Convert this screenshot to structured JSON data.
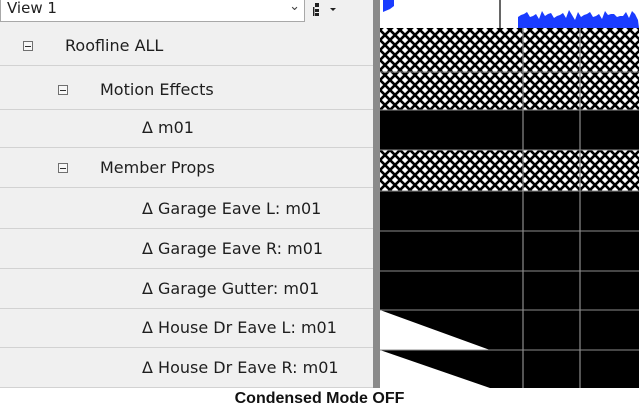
{
  "panel": {
    "view_selector": {
      "value": "View 1",
      "chevron": "chevron-down-icon"
    },
    "view_menu_icon": "tree-view-icon",
    "rows": [
      {
        "label": "Roofline ALL",
        "expandable": true
      },
      {
        "label": "Motion Effects",
        "expandable": true
      },
      {
        "label": "Δ m01",
        "expandable": false
      },
      {
        "label": "Member Props",
        "expandable": true
      },
      {
        "label": "Δ Garage Eave L: m01",
        "expandable": false
      },
      {
        "label": "Δ Garage Eave R: m01",
        "expandable": false
      },
      {
        "label": "Δ Garage Gutter: m01",
        "expandable": false
      },
      {
        "label": "Δ House Dr Eave L: m01",
        "expandable": false
      },
      {
        "label": "Δ House Dr Eave R: m01",
        "expandable": false
      }
    ]
  },
  "timeline": {
    "row_fills": [
      "pattern",
      "pattern",
      "black",
      "pattern",
      "black",
      "black",
      "black",
      "ramp",
      "ramp"
    ],
    "colors": {
      "audio": "#1a3cff",
      "divider": "#8c8c8c"
    }
  },
  "caption": "Condensed Mode OFF"
}
